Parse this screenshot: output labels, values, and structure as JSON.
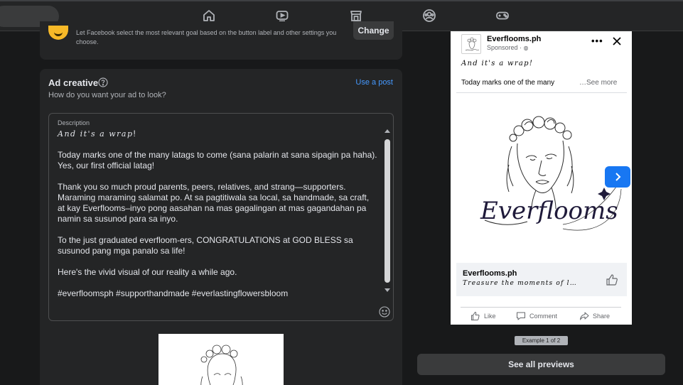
{
  "goal": {
    "hint": "Let Facebook select the most relevant goal based on the button label and other settings you choose.",
    "change_label": "Change"
  },
  "ad_creative": {
    "title": "Ad creative",
    "subtitle": "How do you want your ad to look?",
    "use_post_label": "Use a post",
    "description": {
      "label": "Description",
      "opening": "And it's a wrap",
      "opening_end": "!",
      "body": "Today marks one of the many latags to come (sana palarin at sana sipagin pa haha). Yes, our first official latag!\n\nThank you so much proud parents, peers, relatives, and strang—supporters. Maraming maraming salamat po. At sa pagtitiwala sa local, sa handmade, sa craft, at kay Everflooms–inyo pong aasahan na mas gagalingan at mas gagandahan pa namin sa susunod para sa inyo.\n\nTo the just graduated everfloom-ers, CONGRATULATIONS at GOD BLESS sa susunod pang mga panalo sa life!\n\nHere's the vivid visual of our reality a while ago.\n\n#everfloomsph #supporthandmade #everlastingflowersbloom"
    }
  },
  "preview": {
    "page_name": "Everflooms.ph",
    "sponsored": "Sponsored · ",
    "text_fancy": "And it's a wrap!",
    "text_line": "Today marks one of the many",
    "see_more": "…See more",
    "brand_logo_text": "Everflooms",
    "footer_name": "Everflooms.ph",
    "footer_tagline": "Treasure the moments of l…",
    "actions": {
      "like": "Like",
      "comment": "Comment",
      "share": "Share"
    },
    "example_label": "Example 1 of 2",
    "see_all_label": "See all previews"
  },
  "icons": {
    "nav": [
      "home-icon",
      "watch-icon",
      "marketplace-icon",
      "groups-icon",
      "gaming-icon"
    ]
  },
  "colors": {
    "accent_link": "#4599ff",
    "next_button": "#1877f2",
    "goal_icon": "#f7b928"
  }
}
